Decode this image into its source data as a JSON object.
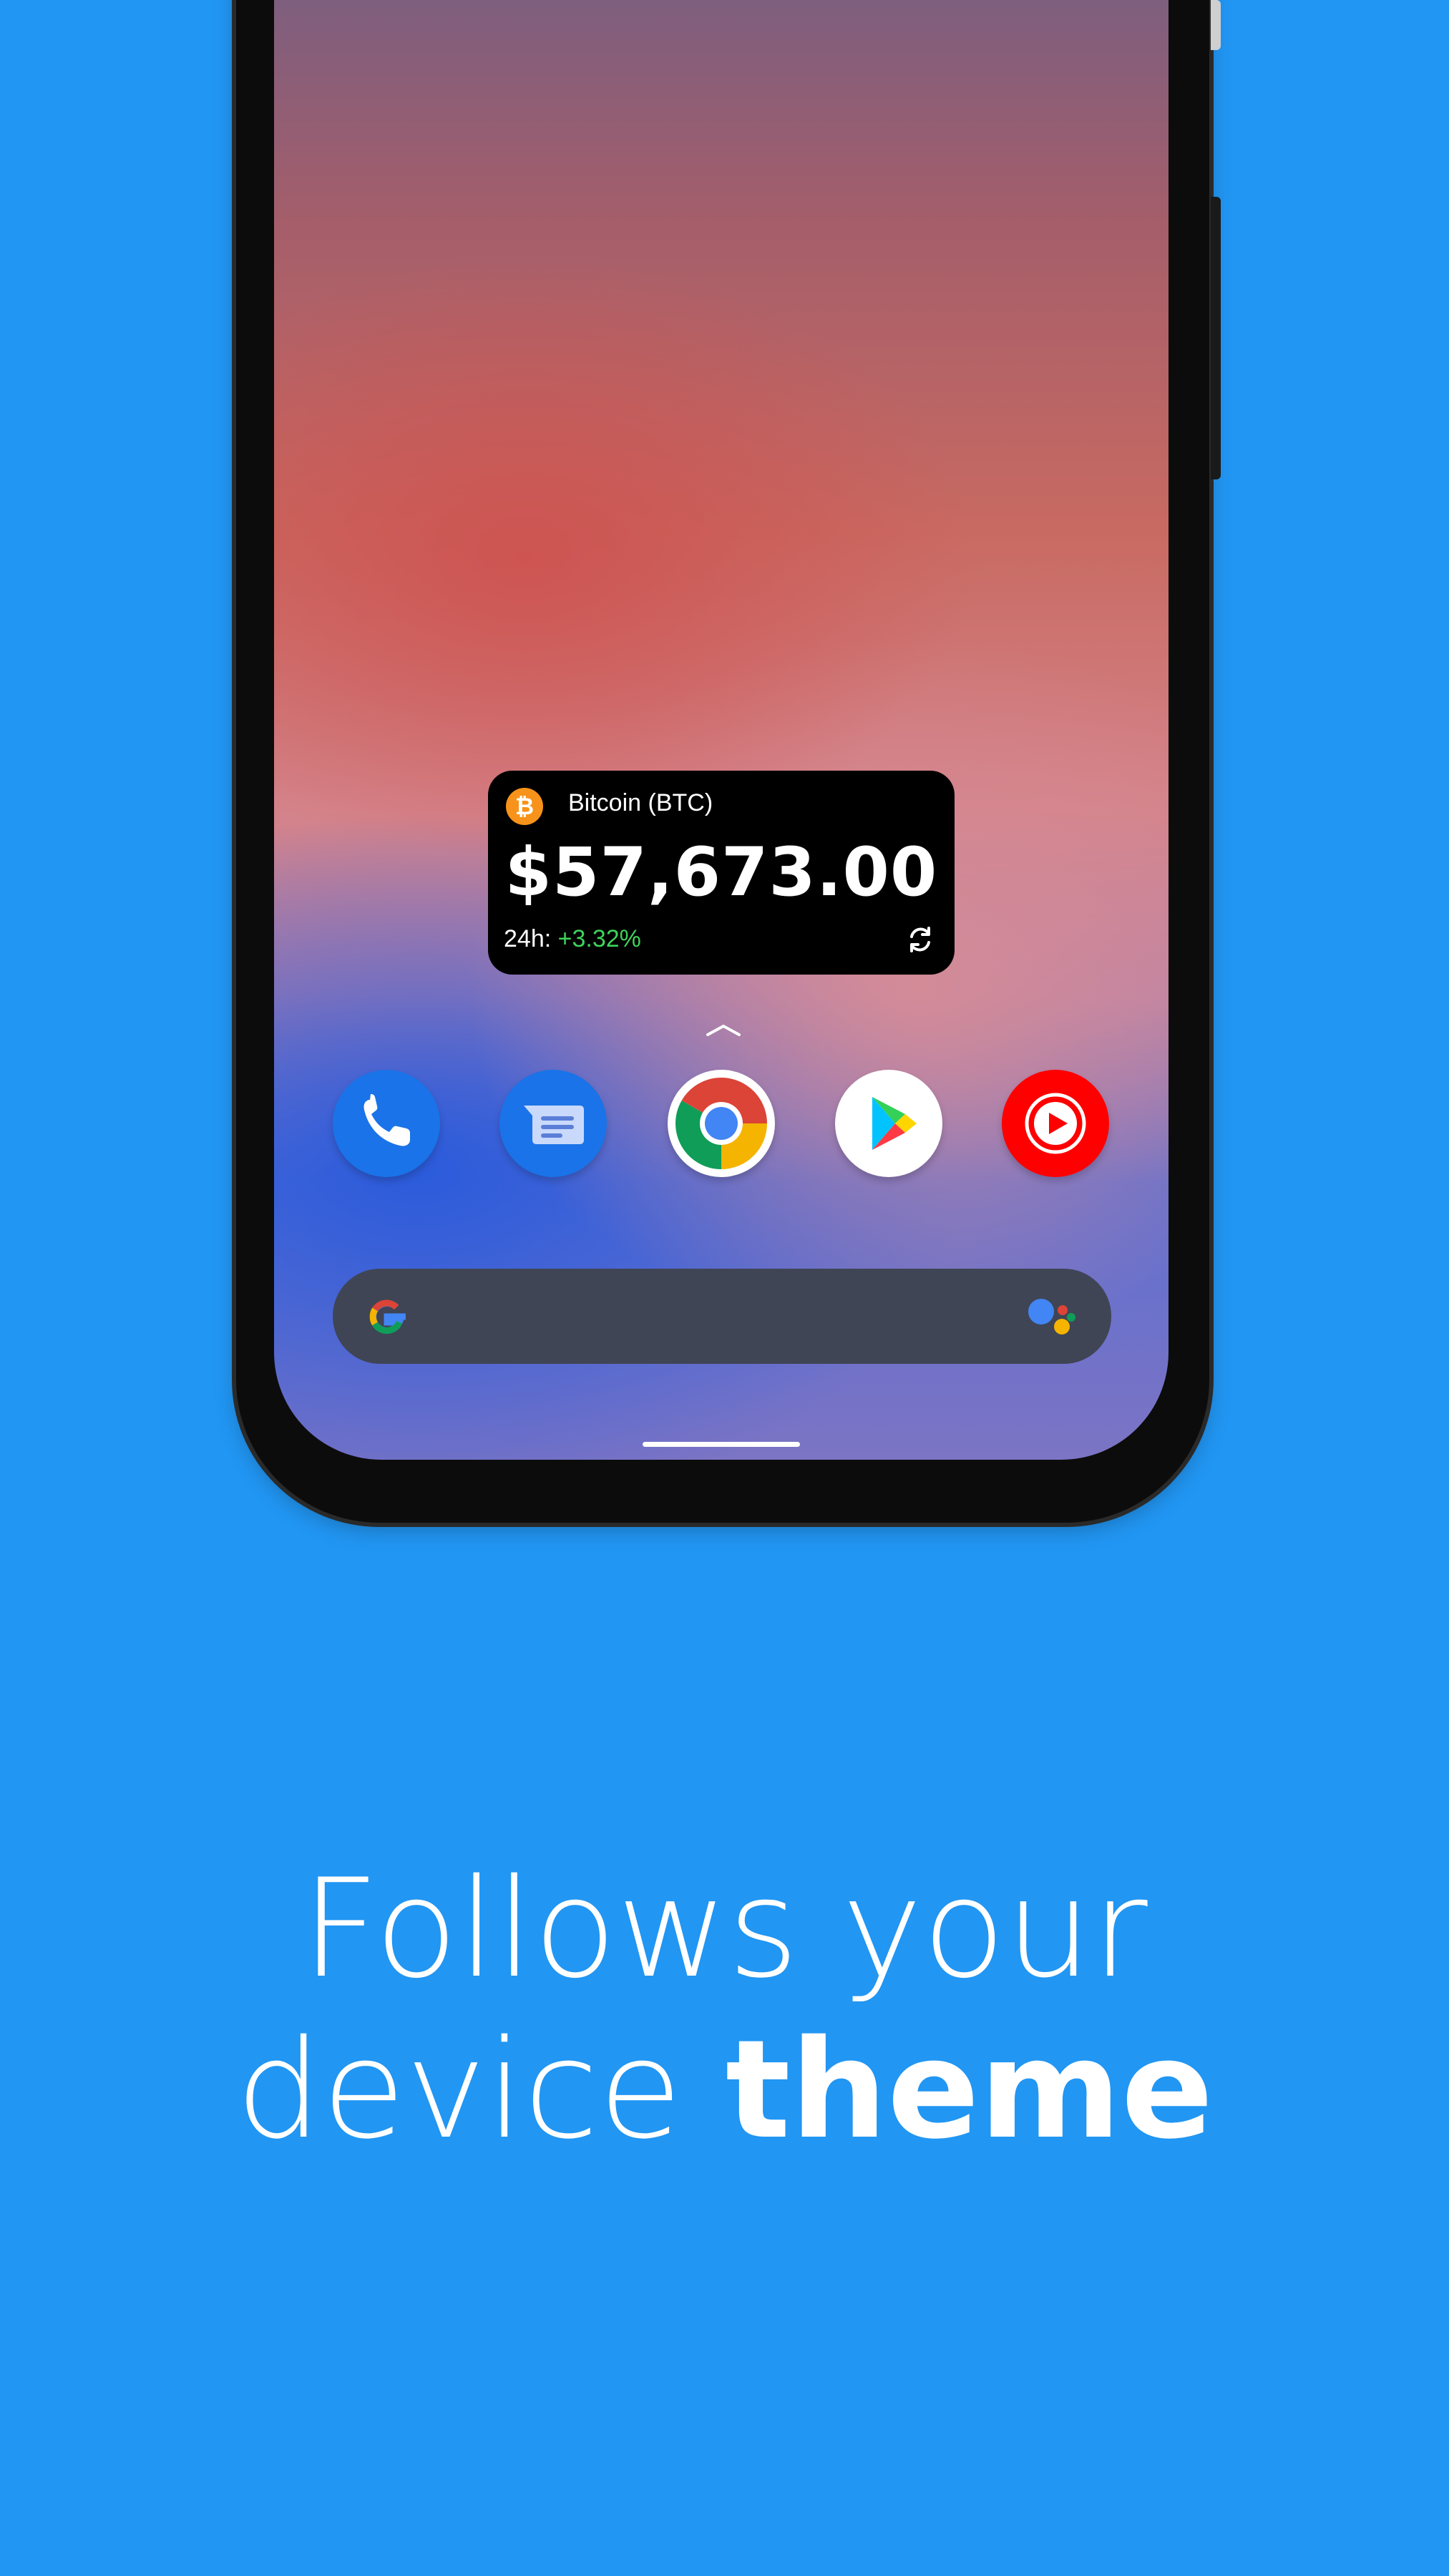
{
  "widget": {
    "coin_symbol": "₿",
    "coin_name": "Bitcoin (BTC)",
    "price": "$57,673.00",
    "change_label": "24h:",
    "change_value": "+3.32%"
  },
  "dock": {
    "apps": [
      "phone-icon",
      "messages-icon",
      "chrome-icon",
      "play-store-icon",
      "youtube-music-icon"
    ]
  },
  "search": {
    "logo": "google-g-icon",
    "assistant": "assistant-icon"
  },
  "caption": {
    "line1": "Follows your",
    "line2_regular": "device",
    "line2_bold": "theme"
  },
  "colors": {
    "background": "#2196F3",
    "widget_bg": "#000000",
    "positive": "#3ed35a",
    "bitcoin": "#F7931A"
  }
}
